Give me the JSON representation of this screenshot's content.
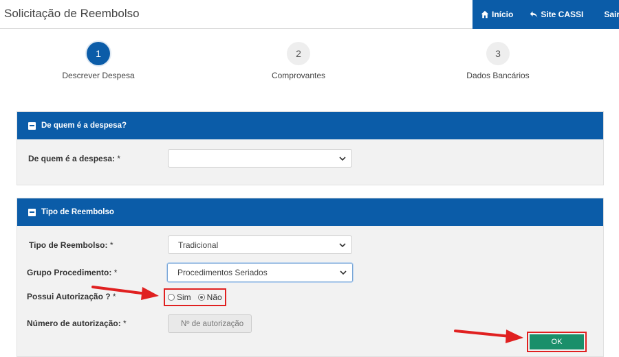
{
  "header": {
    "title": "Solicitação de Reembolso",
    "nav": [
      {
        "label": "Início",
        "icon": "home-icon"
      },
      {
        "label": "Site CASSI",
        "icon": "reply-icon"
      },
      {
        "label": "Sair"
      }
    ]
  },
  "steps": [
    {
      "number": "1",
      "label": "Descrever Despesa",
      "active": true
    },
    {
      "number": "2",
      "label": "Comprovantes",
      "active": false
    },
    {
      "number": "3",
      "label": "Dados Bancários",
      "active": false
    }
  ],
  "panel1": {
    "title": "De quem é a despesa?",
    "field_label": "De quem é a despesa",
    "field_value": ""
  },
  "panel2": {
    "title": "Tipo de Reembolso",
    "tipo_label": "Tipo de Reembolso",
    "tipo_value": "Tradicional",
    "grupo_label": "Grupo Procedimento",
    "grupo_value": "Procedimentos Seriados",
    "autorizacao_label": "Possui Autorização ?",
    "radio_sim": "Sim",
    "radio_nao": "Não",
    "selected": "Não",
    "numero_label": "Número de autorização",
    "numero_placeholder": "Nº de autorização"
  },
  "required_mark": "*",
  "ok_label": "OK",
  "colors": {
    "primary": "#0b5ca8",
    "ok_button": "#1a8f6a",
    "highlight": "#e02020"
  }
}
